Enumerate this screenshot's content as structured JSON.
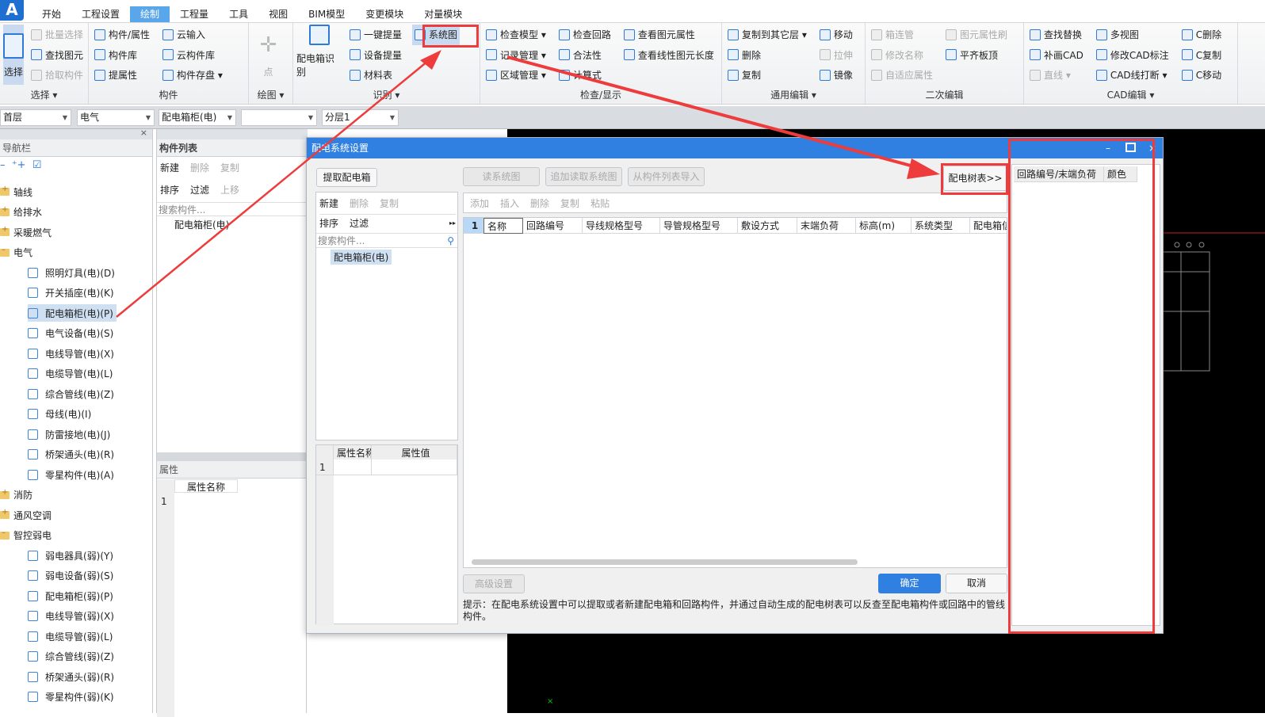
{
  "app": {
    "logo": "A"
  },
  "tabs": [
    "开始",
    "工程设置",
    "绘制",
    "工程量",
    "工具",
    "视图",
    "BIM模型",
    "变更模块",
    "对量模块"
  ],
  "active_tab": "绘制",
  "ribbon": [
    {
      "label": "选择",
      "dropdown": true,
      "big": {
        "label": "选择",
        "icon": "select-icon",
        "selected": true
      },
      "cols": [
        [
          {
            "label": "批量选择",
            "icon": "batch-select-icon",
            "disabled": true
          },
          {
            "label": "查找图元",
            "icon": "find-element-icon"
          },
          {
            "label": "拾取构件",
            "icon": "pick-component-icon",
            "disabled": true
          }
        ]
      ]
    },
    {
      "label": "构件",
      "cols": [
        [
          {
            "label": "构件/属性",
            "icon": "component-property-icon"
          },
          {
            "label": "构件库",
            "icon": "component-library-icon"
          },
          {
            "label": "提属性",
            "icon": "extract-property-icon"
          }
        ],
        [
          {
            "label": "云输入",
            "icon": "cloud-input-icon"
          },
          {
            "label": "云构件库",
            "icon": "cloud-library-icon"
          },
          {
            "label": "构件存盘 ▾",
            "icon": "component-save-icon"
          }
        ]
      ]
    },
    {
      "label": "绘图",
      "dropdown": true,
      "big": {
        "label": "点",
        "icon": "point-icon",
        "disabled": true
      },
      "cols": []
    },
    {
      "label": "识别",
      "dropdown": true,
      "big": {
        "label": "配电箱识别",
        "icon": "distribution-box-recognize-icon"
      },
      "cols": [
        [
          {
            "label": "一键提量",
            "icon": "one-click-quantity-icon"
          },
          {
            "label": "设备提量",
            "icon": "device-quantity-icon"
          },
          {
            "label": "材料表",
            "icon": "material-table-icon"
          }
        ],
        [
          {
            "label": "系统图",
            "icon": "system-diagram-icon",
            "highlight": true
          }
        ]
      ]
    },
    {
      "label": "检查/显示",
      "cols": [
        [
          {
            "label": "检查模型 ▾",
            "icon": "check-model-icon"
          },
          {
            "label": "记录管理 ▾",
            "icon": "record-manage-icon"
          },
          {
            "label": "区域管理 ▾",
            "icon": "region-manage-icon"
          }
        ],
        [
          {
            "label": "检查回路",
            "icon": "check-circuit-icon"
          },
          {
            "label": "合法性",
            "icon": "checkmark-icon"
          },
          {
            "label": "计算式",
            "icon": "calculator-icon"
          }
        ],
        [
          {
            "label": "查看图元属性",
            "icon": "view-element-property-icon"
          },
          {
            "label": "查看线性图元长度",
            "icon": "view-line-length-icon"
          }
        ]
      ]
    },
    {
      "label": "通用编辑",
      "dropdown": true,
      "cols": [
        [
          {
            "label": "复制到其它层 ▾",
            "icon": "copy-to-layer-icon"
          },
          {
            "label": "删除",
            "icon": "delete-icon"
          },
          {
            "label": "复制",
            "icon": "copy-icon"
          }
        ],
        [
          {
            "label": "移动",
            "icon": "move-icon"
          },
          {
            "label": "拉伸",
            "icon": "stretch-icon",
            "disabled": true
          },
          {
            "label": "镜像",
            "icon": "mirror-icon"
          }
        ]
      ]
    },
    {
      "label": "二次编辑",
      "cols": [
        [
          {
            "label": "箱连管",
            "icon": "box-connect-pipe-icon",
            "disabled": true
          },
          {
            "label": "修改名称",
            "icon": "rename-icon",
            "disabled": true
          },
          {
            "label": "自适应属性",
            "icon": "adaptive-property-icon",
            "disabled": true
          }
        ],
        [
          {
            "label": "图元属性刷",
            "icon": "property-brush-icon",
            "disabled": true
          },
          {
            "label": "平齐板顶",
            "icon": "align-slab-top-icon"
          }
        ]
      ]
    },
    {
      "label": "CAD编辑",
      "dropdown": true,
      "cols": [
        [
          {
            "label": "查找替换",
            "icon": "find-replace-icon"
          },
          {
            "label": "补画CAD",
            "icon": "redraw-cad-icon"
          },
          {
            "label": "直线 ▾",
            "icon": "line-icon",
            "disabled": true
          }
        ],
        [
          {
            "label": "多视图",
            "icon": "multi-view-icon"
          },
          {
            "label": "修改CAD标注",
            "icon": "edit-cad-annotation-icon"
          },
          {
            "label": "CAD线打断 ▾",
            "icon": "cad-line-break-icon"
          }
        ],
        [
          {
            "label": "C删除",
            "icon": "c-delete-icon"
          },
          {
            "label": "C复制",
            "icon": "c-copy-icon"
          },
          {
            "label": "C移动",
            "icon": "c-move-icon"
          }
        ]
      ]
    }
  ],
  "toolbar": {
    "floor": "首层",
    "discipline": "电气",
    "component_type": "配电箱柜(电)",
    "component": "",
    "sublayer": "分层1"
  },
  "nav": {
    "title": "导航栏",
    "items": [
      {
        "label": "轴线",
        "type": "folder"
      },
      {
        "label": "给排水",
        "type": "folder"
      },
      {
        "label": "采暖燃气",
        "type": "folder"
      },
      {
        "label": "电气",
        "type": "folder",
        "open": true
      },
      {
        "label": "照明灯具(电)(D)"
      },
      {
        "label": "开关插座(电)(K)"
      },
      {
        "label": "配电箱柜(电)(P)",
        "selected": true
      },
      {
        "label": "电气设备(电)(S)"
      },
      {
        "label": "电线导管(电)(X)"
      },
      {
        "label": "电缆导管(电)(L)"
      },
      {
        "label": "综合管线(电)(Z)"
      },
      {
        "label": "母线(电)(I)"
      },
      {
        "label": "防雷接地(电)(J)"
      },
      {
        "label": "桥架通头(电)(R)"
      },
      {
        "label": "零星构件(电)(A)"
      },
      {
        "label": "消防",
        "type": "folder"
      },
      {
        "label": "通风空调",
        "type": "folder"
      },
      {
        "label": "智控弱电",
        "type": "folder",
        "open": true
      },
      {
        "label": "弱电器具(弱)(Y)"
      },
      {
        "label": "弱电设备(弱)(S)"
      },
      {
        "label": "配电箱柜(弱)(P)"
      },
      {
        "label": "电线导管(弱)(X)"
      },
      {
        "label": "电缆导管(弱)(L)"
      },
      {
        "label": "综合管线(弱)(Z)"
      },
      {
        "label": "桥架通头(弱)(R)"
      },
      {
        "label": "零星构件(弱)(K)"
      }
    ]
  },
  "component_list": {
    "title": "构件列表",
    "new": "新建",
    "delete": "删除",
    "copy": "复制",
    "sort": "排序",
    "filter": "过滤",
    "move_up": "上移",
    "search_placeholder": "搜索构件...",
    "items": [
      "配电箱柜(电)"
    ]
  },
  "properties": {
    "title": "属性",
    "col_name": "属性名称",
    "row": "1"
  },
  "dialog": {
    "title": "配电系统设置",
    "extract_box": "提取配电箱",
    "read_diagram": "读系统图",
    "append_read": "追加读取系统图",
    "import_from_list": "从构件列表导入",
    "tree_table_btn": "配电树表>>",
    "left_toolbar": {
      "new": "新建",
      "delete": "删除",
      "copy": "复制",
      "sort": "排序",
      "filter": "过滤",
      "search_placeholder": "搜索构件...",
      "items": [
        "配电箱柜(电)"
      ]
    },
    "prop_grid": {
      "col_name": "属性名称",
      "col_value": "属性值",
      "row": "1"
    },
    "grid_toolbar": {
      "add": "添加",
      "insert": "插入",
      "delete": "删除",
      "copy": "复制",
      "paste": "粘贴"
    },
    "columns": [
      "名称",
      "回路编号",
      "导线规格型号",
      "导管规格型号",
      "敷设方式",
      "末端负荷",
      "标高(m)",
      "系统类型",
      "配电箱信"
    ],
    "row_number": "1",
    "advanced": "高级设置",
    "ok": "确定",
    "cancel": "取消",
    "hint": "提示：在配电系统设置中可以提取或者新建配电箱和回路构件，并通过自动生成的配电树表可以反查至配电箱构件或回路中的管线构件。",
    "tree_panel": {
      "col_circuit": "回路编号/末端负荷",
      "col_color": "颜色"
    }
  },
  "colors": {
    "accent": "#2f80e0",
    "annotation": "#ee3b3b",
    "cad_bg": "#000000"
  }
}
